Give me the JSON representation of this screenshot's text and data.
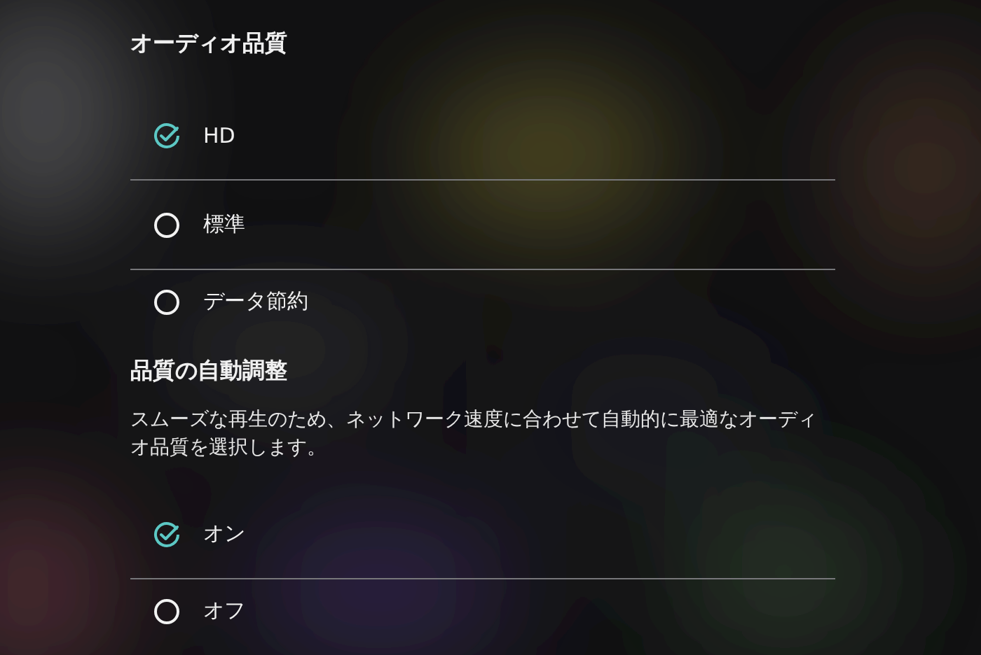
{
  "sections": [
    {
      "title": "オーディオ品質",
      "options": [
        {
          "label": "HD",
          "selected": true
        },
        {
          "label": "標準",
          "selected": false
        },
        {
          "label": "データ節約",
          "selected": false
        }
      ]
    },
    {
      "title": "品質の自動調整",
      "description": "スムーズな再生のため、ネットワーク速度に合わせて自動的に最適なオーディオ品質を選択します。",
      "options": [
        {
          "label": "オン",
          "selected": true
        },
        {
          "label": "オフ",
          "selected": false
        }
      ]
    }
  ]
}
